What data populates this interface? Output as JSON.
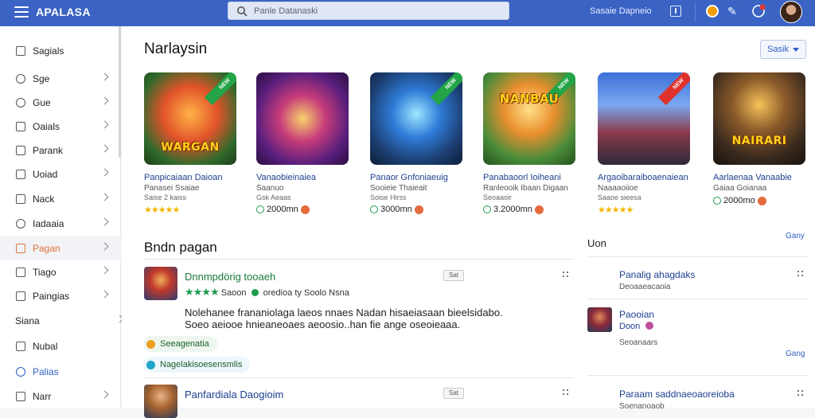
{
  "topbar": {
    "brand": "APALASA",
    "search_placeholder": "Panle Datanaski",
    "link": "Sasaie Dapneio",
    "accent": "#3a63c4"
  },
  "sidebar": {
    "items": [
      {
        "label": "Sagials",
        "icon": "bag-icon",
        "chevron": false
      },
      {
        "label": "Sge",
        "icon": "globe-icon",
        "chevron": true
      },
      {
        "label": "Gue",
        "icon": "cloud-icon",
        "chevron": true
      },
      {
        "label": "Oaials",
        "icon": "document-icon",
        "chevron": true
      },
      {
        "label": "Parank",
        "icon": "page-icon",
        "chevron": true
      },
      {
        "label": "Uoiad",
        "icon": "square-icon",
        "chevron": true
      },
      {
        "label": "Nack",
        "icon": "box-icon",
        "chevron": true
      },
      {
        "label": "Iadaaia",
        "icon": "shield-icon",
        "chevron": true
      },
      {
        "label": "Pagan",
        "icon": "tag-icon",
        "chevron": true
      },
      {
        "label": "Tiago",
        "icon": "tray-icon",
        "chevron": true
      },
      {
        "label": "Paingias",
        "icon": "list-icon",
        "chevron": true
      },
      {
        "label": "Siana",
        "icon": "",
        "chevron": true
      },
      {
        "label": "Nubal",
        "icon": "monitor-icon",
        "chevron": false
      },
      {
        "label": "Palias",
        "icon": "gear-icon",
        "chevron": false
      },
      {
        "label": "Narr",
        "icon": "user-icon",
        "chevron": true
      }
    ]
  },
  "featured": {
    "title": "Narlaysin",
    "sort_label": "Sasik",
    "cards": [
      {
        "art": "WARGAN",
        "ribbon": "NEW",
        "name": "Panpicaiaan Daioan",
        "sub": "Panasei Ssaiae",
        "sub2": "Saise 2 kaiss",
        "rating": "★★★★★",
        "price": ""
      },
      {
        "art": "",
        "ribbon": "",
        "name": "Vanaobieinaiea",
        "sub": "Saanuo",
        "sub2": "Gsk Aeaas",
        "rating": "",
        "price": "2000mn"
      },
      {
        "art": "",
        "ribbon": "NEW",
        "name": "Panaor Gnfoniaeuig",
        "sub": "Sooieie Thaieait",
        "sub2": "Soise Hirss",
        "rating": "",
        "price": "3000mn"
      },
      {
        "art": "NANBAU",
        "ribbon": "NEW",
        "name": "Panabaoorl Ioiheani",
        "sub": "Ranleooik Ibaan Digaan",
        "sub2": "Seoaaoir",
        "rating": "",
        "price": "3.2000mn"
      },
      {
        "art": "",
        "ribbon": "NEW",
        "name": "Argaoibaraiboaenaiean",
        "sub": "Naaaaoiioe",
        "sub2": "Saaoe sieesa",
        "rating": "★★★★★",
        "price": ""
      },
      {
        "art": "NAIRARI",
        "ribbon": "",
        "name": "Aarlaenaa Vanaabie",
        "sub": "Gaiaa Goianaa",
        "sub2": "",
        "rating": "",
        "price": "2000mo"
      }
    ]
  },
  "list": {
    "title": "Bndn pagan",
    "items": [
      {
        "title": "Dnnmpdörig tooaeh",
        "stars": "★★★★",
        "meta": "Saoon",
        "meta2": "oredioa ty Soolo Nsna",
        "badge": "Sat"
      },
      {
        "title": "Panfardiala Daogioim",
        "stars": "",
        "meta": "",
        "meta2": "",
        "badge": "Sat"
      }
    ],
    "description_line1": "Nolehanee frananiolaga laeos nnaes Nadan hisaeiasaan bieelsidabo.",
    "description_line2": "Soeo aeiooe hnieaneoaes aeoosio..han fie ange oseoieaaa.",
    "chips": [
      "Seeagenatia",
      "Nagelakisoesensmlis"
    ]
  },
  "right_panel": {
    "title": "Uon",
    "link_top": "Gany",
    "link_bottom": "Gang",
    "items": [
      {
        "title": "Panalig ahagdaks",
        "sub": "Deoaaeacaoia"
      },
      {
        "title": "Paooian",
        "sub": "Doon",
        "sub2": "Seoanaars"
      },
      {
        "title": "Paraam saddnaeoaoreioba",
        "sub": "Soenanoaob"
      }
    ]
  }
}
